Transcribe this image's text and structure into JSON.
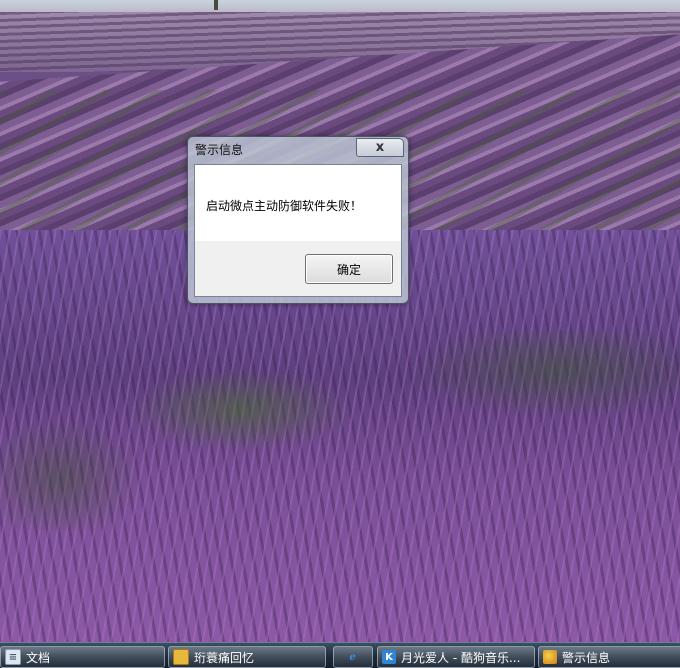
{
  "dialog": {
    "title": "警示信息",
    "close_label": "x",
    "message": "启动微点主动防御软件失败！",
    "ok_label": "确定"
  },
  "taskbar": {
    "items": [
      {
        "label": "文档",
        "icon": "document-icon"
      },
      {
        "label": "珩蓑痛回忆",
        "icon": "folder-icon"
      },
      {
        "label": "",
        "icon": "internet-explorer-icon"
      },
      {
        "label": "月光爱人 - 酷狗音乐...",
        "icon": "kugou-music-icon"
      },
      {
        "label": "警示信息",
        "icon": "alert-app-icon"
      }
    ]
  },
  "colors": {
    "taskbar": "#1c2a3a",
    "dialog_frame": "#bec8d6",
    "wallpaper_accent": "#7a5a8e"
  }
}
